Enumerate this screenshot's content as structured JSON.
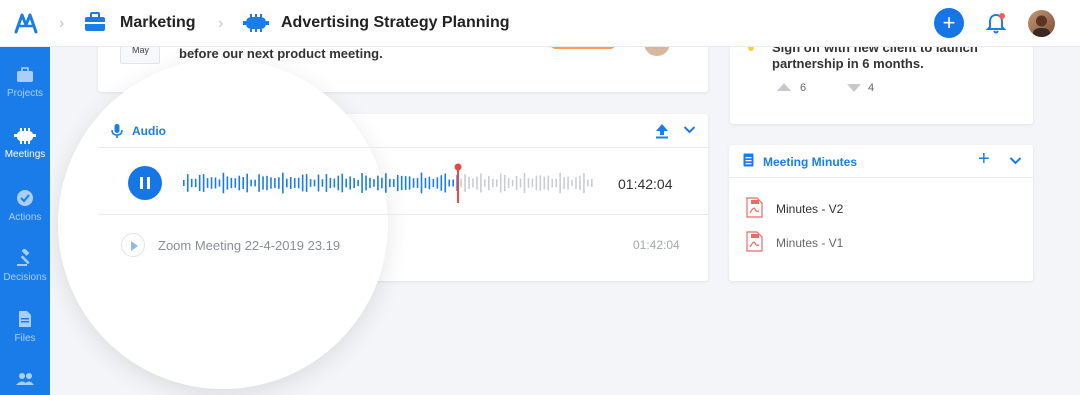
{
  "breadcrumb": {
    "workspace": "Marketing",
    "project": "Advertising Strategy Planning"
  },
  "sidebar": {
    "items": [
      {
        "label": "Projects",
        "icon": "briefcase-icon"
      },
      {
        "label": "Meetings",
        "icon": "meeting-icon"
      },
      {
        "label": "Actions",
        "icon": "check-circle-icon"
      },
      {
        "label": "Decisions",
        "icon": "gavel-icon"
      },
      {
        "label": "Files",
        "icon": "file-icon"
      },
      {
        "label": "",
        "icon": "people-icon"
      }
    ]
  },
  "top_card": {
    "date_month": "May",
    "text": "before our next product meeting."
  },
  "right_top_card": {
    "text_line1": "Sign off with new client to launch",
    "text_line2": "partnership in 6 months.",
    "upvotes": "6",
    "downvotes": "4"
  },
  "audio": {
    "title": "Audio",
    "current_time": "01:42:04",
    "progress": 0.67,
    "recording_name": "Zoom Meeting 22-4-2019 23.19",
    "recording_duration": "01:42:04"
  },
  "minutes": {
    "title": "Meeting Minutes",
    "items": [
      "Minutes - V2",
      "Minutes - V1"
    ]
  },
  "colors": {
    "accent": "#1a7ce8",
    "playhead": "#e84545",
    "notification_dot": "#ff5a4e"
  }
}
